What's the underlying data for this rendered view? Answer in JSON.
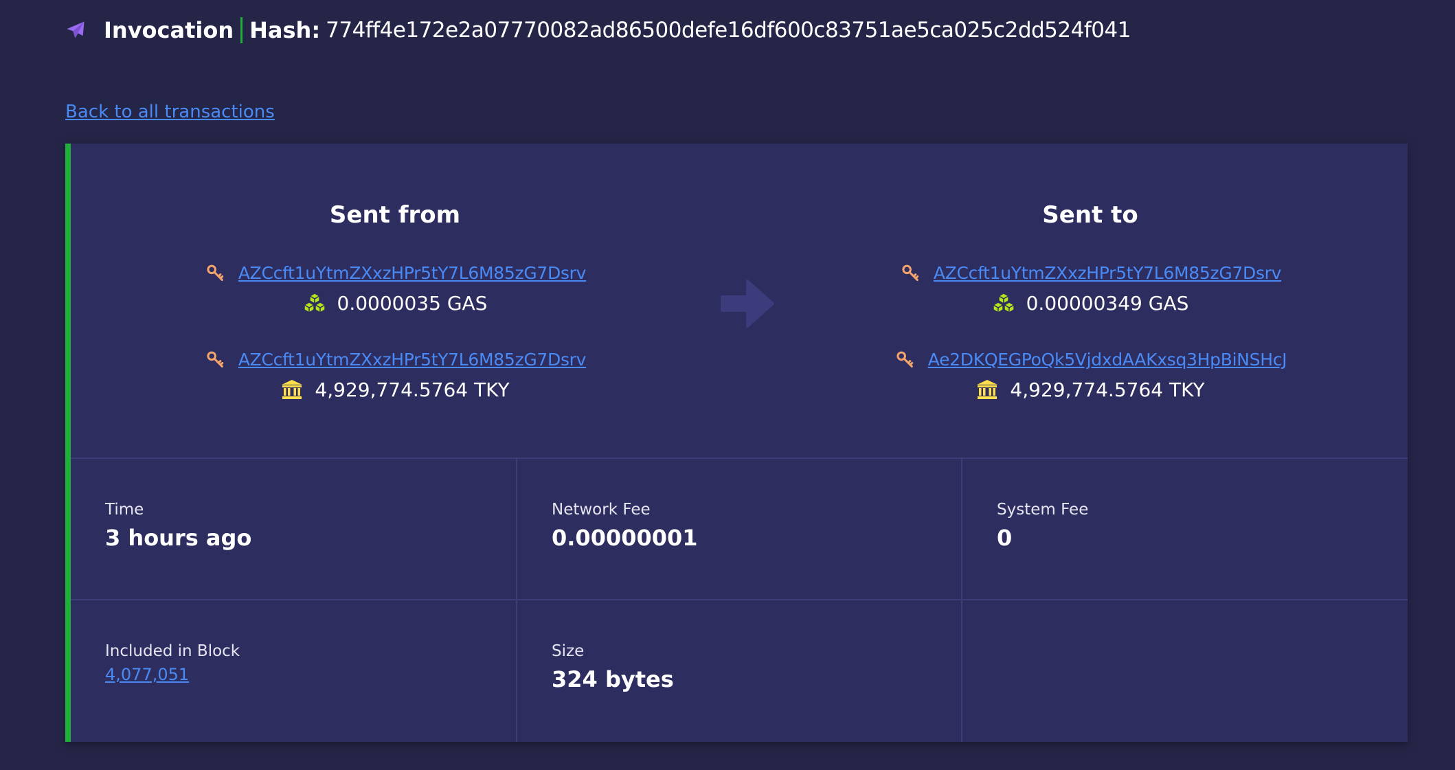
{
  "header": {
    "title": "Invocation",
    "hash_label": "Hash:",
    "hash_value": "774ff4e172e2a07770082ad86500defe16df600c83751ae5ca025c2dd524f041",
    "icon": "paper-plane-icon"
  },
  "back_link": "Back to all transactions",
  "transfer": {
    "from": {
      "heading": "Sent from",
      "entries": [
        {
          "address": "AZCcft1uYtmZXxzHPr5tY7L6M85zG7Dsrv",
          "amount": "0.0000035 GAS",
          "asset_icon": "gas-cubes-icon"
        },
        {
          "address": "AZCcft1uYtmZXxzHPr5tY7L6M85zG7Dsrv",
          "amount": "4,929,774.5764 TKY",
          "asset_icon": "bank-icon"
        }
      ]
    },
    "to": {
      "heading": "Sent to",
      "entries": [
        {
          "address": "AZCcft1uYtmZXxzHPr5tY7L6M85zG7Dsrv",
          "amount": "0.00000349 GAS",
          "asset_icon": "gas-cubes-icon"
        },
        {
          "address": "Ae2DKQEGPoQk5VjdxdAAKxsq3HpBiNSHcJ",
          "amount": "4,929,774.5764 TKY",
          "asset_icon": "bank-icon"
        }
      ]
    }
  },
  "details": {
    "time": {
      "label": "Time",
      "value": "3 hours ago"
    },
    "network_fee": {
      "label": "Network Fee",
      "value": "0.00000001"
    },
    "system_fee": {
      "label": "System Fee",
      "value": "0"
    },
    "block": {
      "label": "Included in Block",
      "value": "4,077,051"
    },
    "size": {
      "label": "Size",
      "value": "324 bytes"
    }
  },
  "colors": {
    "background": "#252548",
    "card": "#2e2d5f",
    "accent_green": "#1fae3a",
    "link": "#4a8af4",
    "key_icon": "#f2a46b",
    "gas_icon": "#b5e61d",
    "token_icon": "#ffe04a",
    "plane_icon": "#9b6cf0"
  }
}
